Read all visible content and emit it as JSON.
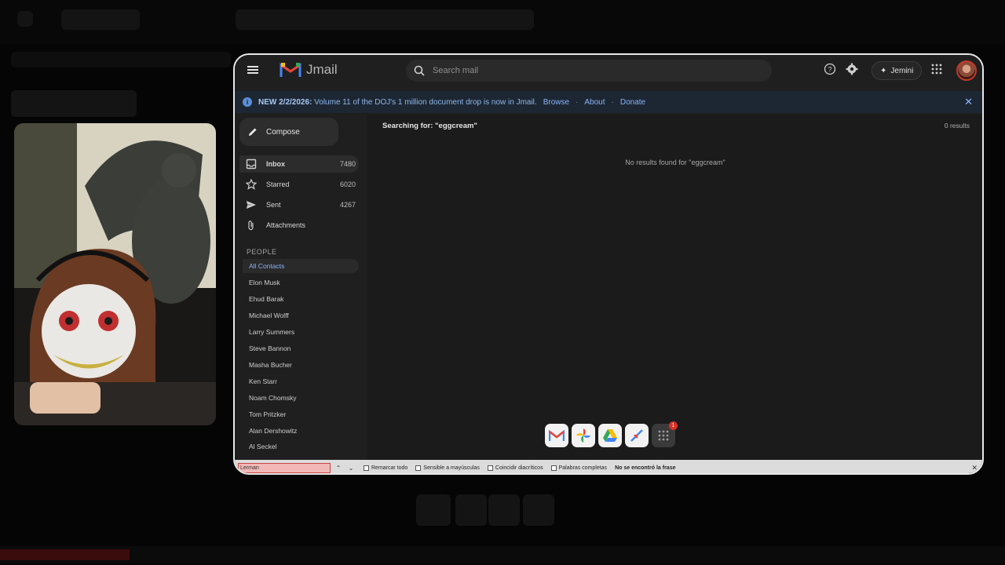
{
  "app": {
    "name": "Jmail"
  },
  "search": {
    "placeholder": "Search mail"
  },
  "header": {
    "jemini_label": "Jemini"
  },
  "banner": {
    "date": "NEW 2/2/2026:",
    "text": "Volume 11 of the DOJ's 1 million document drop is now in Jmail.",
    "links": [
      "Browse",
      "About",
      "Donate"
    ]
  },
  "compose": {
    "label": "Compose"
  },
  "nav": [
    {
      "label": "Inbox",
      "count": "7480",
      "icon": "inbox-icon"
    },
    {
      "label": "Starred",
      "count": "6020",
      "icon": "star-icon"
    },
    {
      "label": "Sent",
      "count": "4267",
      "icon": "send-icon"
    },
    {
      "label": "Attachments",
      "count": "",
      "icon": "paperclip-icon"
    }
  ],
  "people": {
    "label": "PEOPLE",
    "contacts": [
      "All Contacts",
      "Elon Musk",
      "Ehud Barak",
      "Michael Wolff",
      "Larry Summers",
      "Steve Bannon",
      "Masha Bucher",
      "Ken Starr",
      "Noam Chomsky",
      "Tom Pritzker",
      "Alan Dershowitz",
      "Al Seckel"
    ]
  },
  "main": {
    "searching": "Searching for: \"eggcream\"",
    "results": "0 results",
    "noresults": "No results found for \"eggcream\""
  },
  "dock": [
    "mail-app-icon",
    "photos-app-icon",
    "drive-app-icon",
    "flights-app-icon",
    "apps-grid-icon"
  ],
  "dock_badge": "1",
  "findbar": {
    "value": "Lerman",
    "options": [
      "Remarcar todo",
      "Sensible a mayúsculas",
      "Coincidir diacríticos",
      "Palabras completas"
    ],
    "status": "No se encontró la frase"
  },
  "colors": {
    "accent": "#8ab4f8",
    "banner_bg": "#1d2733",
    "window_bg": "#1f1f1f"
  }
}
